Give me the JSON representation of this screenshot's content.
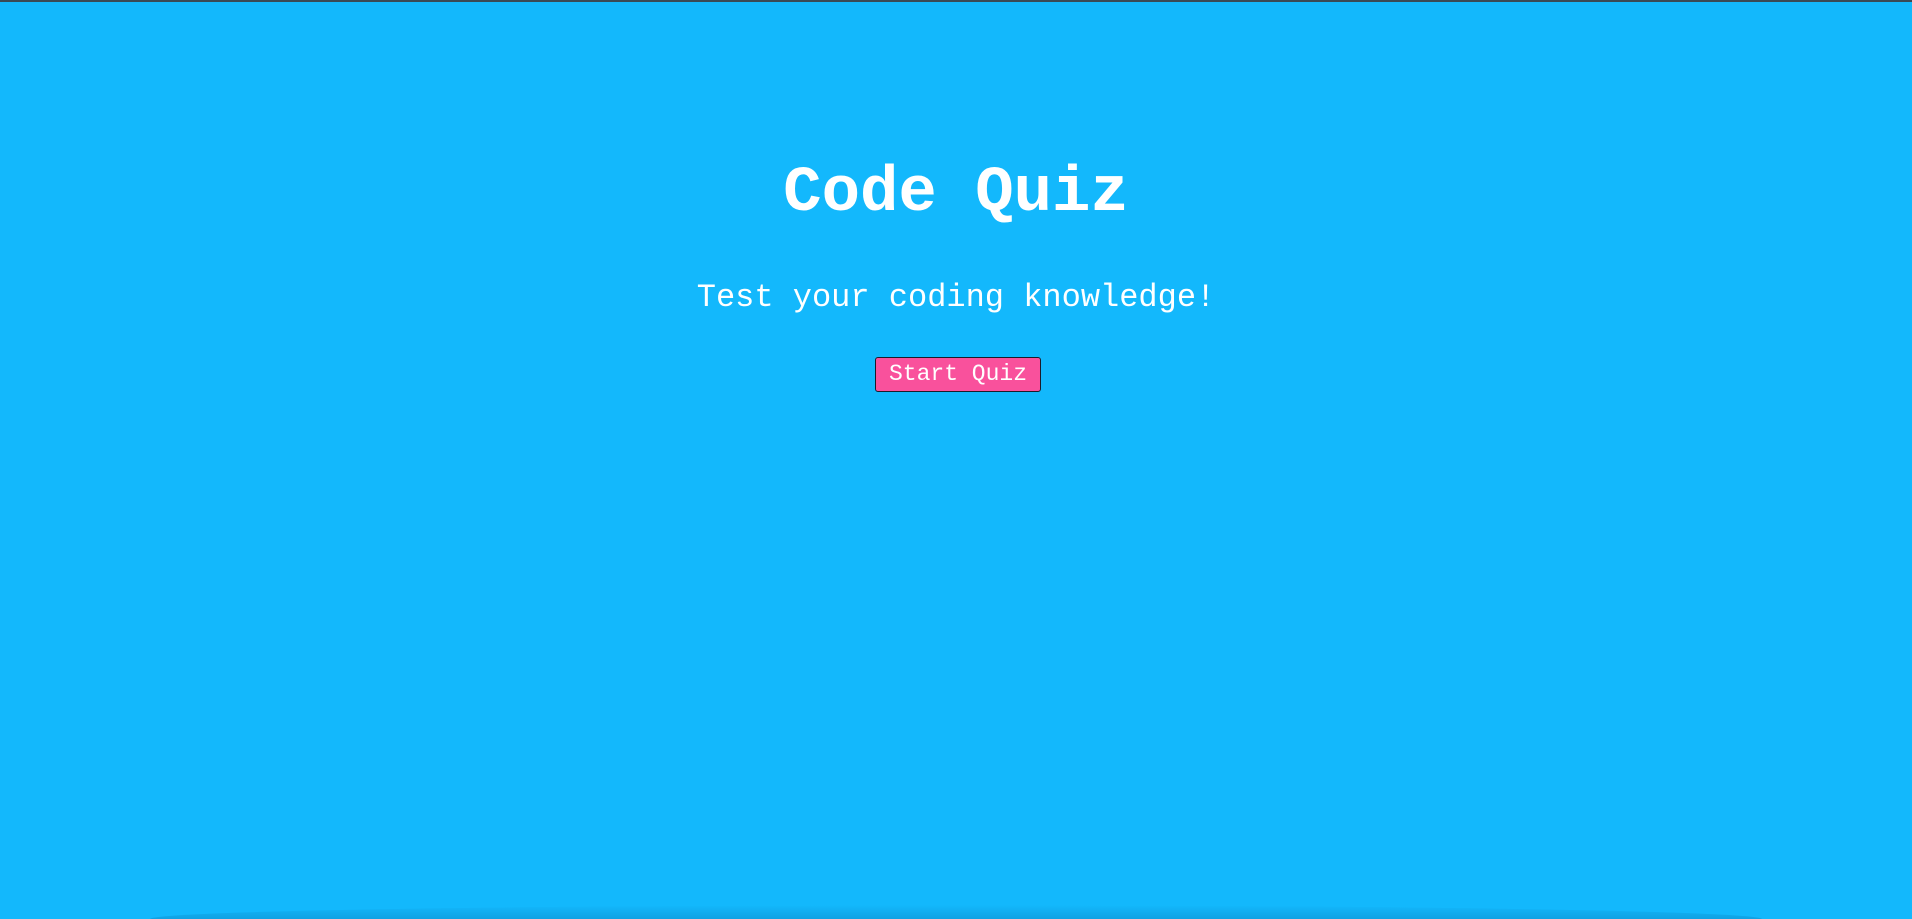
{
  "landing": {
    "title": "Code Quiz",
    "subtitle": "Test your coding knowledge!",
    "start_button_label": "Start Quiz"
  },
  "colors": {
    "background": "#13b8fc",
    "text": "#ffffff",
    "button_background": "#f9519c"
  }
}
